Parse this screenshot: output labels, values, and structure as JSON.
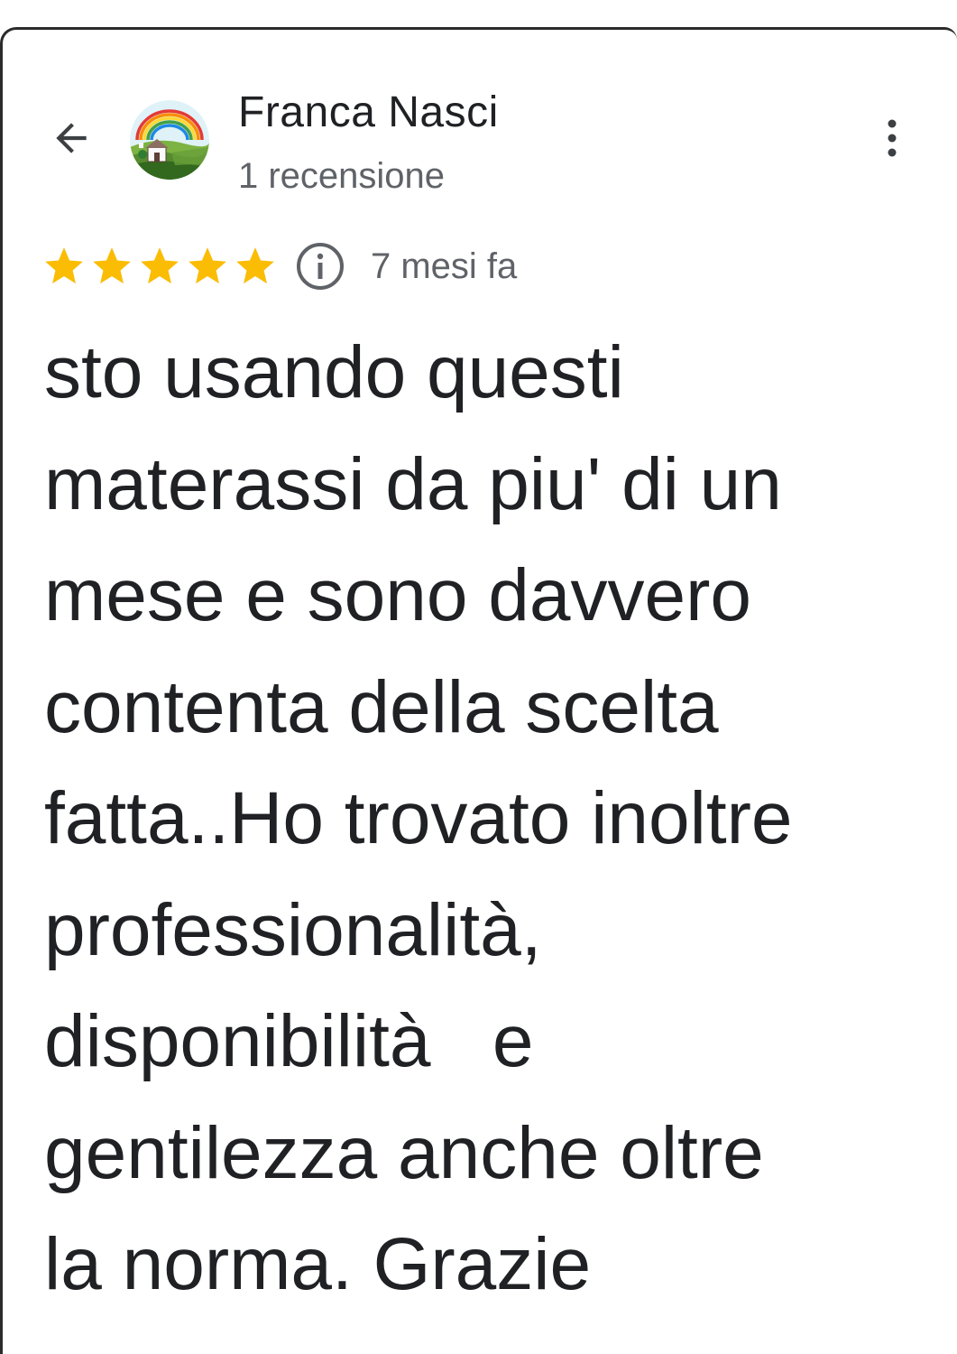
{
  "header": {
    "back_icon": "arrow-back-icon",
    "avatar_icon": "rainbow-landscape-avatar",
    "reviewer_name": "Franca Nasci",
    "review_count": "1 recensione",
    "more_icon": "more-vert-icon"
  },
  "rating": {
    "stars": 5,
    "max_stars": 5,
    "info_icon": "info-icon",
    "date": "7 mesi fa",
    "star_color": "#fbbc04"
  },
  "review": {
    "lines": [
      "sto usando questi",
      "materassi da piu' di un",
      "mese e sono davvero",
      "contenta della scelta",
      "fatta..Ho trovato inoltre",
      "professionalità,",
      "disponibilità   e",
      "gentilezza anche oltre",
      "la norma. Grazie"
    ]
  }
}
